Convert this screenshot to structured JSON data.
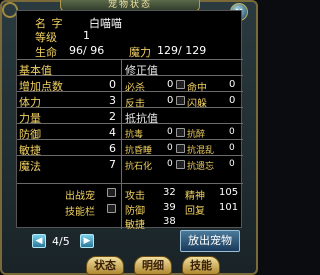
{
  "window": {
    "title": "宠物状态",
    "close_label": "×"
  },
  "header": {
    "name_label": "名  字",
    "name_value": "白喵喵",
    "level_label": "等级",
    "level_value": "1",
    "hp_label": "生命",
    "hp_value": "96/  96",
    "mp_label": "魔力",
    "mp_value": "129/ 129"
  },
  "base_stats": {
    "title": "基本值",
    "items": [
      {
        "label": "增加点数",
        "value": "0"
      },
      {
        "label": "体力",
        "value": "3"
      },
      {
        "label": "力量",
        "value": "2"
      },
      {
        "label": "防御",
        "value": "4"
      },
      {
        "label": "敏捷",
        "value": "6"
      },
      {
        "label": "魔法",
        "value": "7"
      }
    ]
  },
  "correction": {
    "title": "修正值",
    "items": [
      {
        "label": "必杀",
        "value": "0",
        "label2": "命中",
        "value2": "0"
      },
      {
        "label": "反击",
        "value": "0",
        "label2": "闪躲",
        "value2": "0"
      }
    ]
  },
  "resistance": {
    "title": "抵抗值",
    "items": [
      {
        "label": "抗毒",
        "value": "0",
        "label2": "抗醉",
        "value2": "0"
      },
      {
        "label": "抗昏睡",
        "value": "0",
        "label2": "抗混乱",
        "value2": "0"
      },
      {
        "label": "抗石化",
        "value": "0",
        "label2": "抗遗忘",
        "value2": "0"
      }
    ]
  },
  "battle": {
    "deploy_label": "出战宠",
    "skill_label": "技能栏",
    "attack_label": "攻击",
    "attack_value": "32",
    "agility_label": "精神",
    "agility_value": "105",
    "defense_label": "防御",
    "defense_value": "39",
    "recover_label": "回复",
    "recover_value": "101",
    "speed_label": "敏捷",
    "speed_value": "38"
  },
  "footer": {
    "page": "4/5",
    "prev_label": "◀",
    "next_label": "▶",
    "release_label": "放出宠物"
  },
  "tabs": [
    "状态",
    "明细",
    "技能"
  ]
}
